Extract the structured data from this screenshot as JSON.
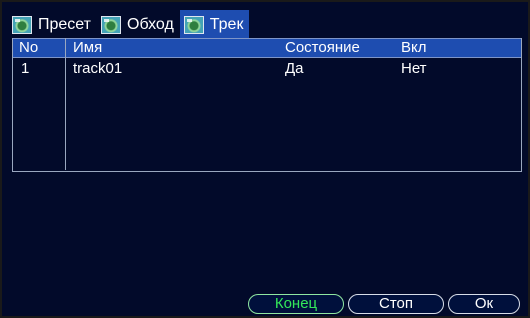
{
  "tabs": [
    {
      "label": "Пресет",
      "active": false,
      "icon": "camera-icon"
    },
    {
      "label": "Обход",
      "active": false,
      "icon": "camera-icon"
    },
    {
      "label": "Трек",
      "active": true,
      "icon": "camera-icon"
    }
  ],
  "table": {
    "headers": {
      "no": "No",
      "name": "Имя",
      "state": "Состояние",
      "enabled": "Вкл"
    },
    "rows": [
      {
        "no": "1",
        "name": "track01",
        "state": "Да",
        "enabled": "Нет"
      }
    ]
  },
  "buttons": {
    "end": "Конец",
    "stop": "Стоп",
    "ok": "Ок"
  },
  "colors": {
    "background": "#020a2a",
    "header": "#1e4db0",
    "active_button_text": "#33e85a"
  }
}
